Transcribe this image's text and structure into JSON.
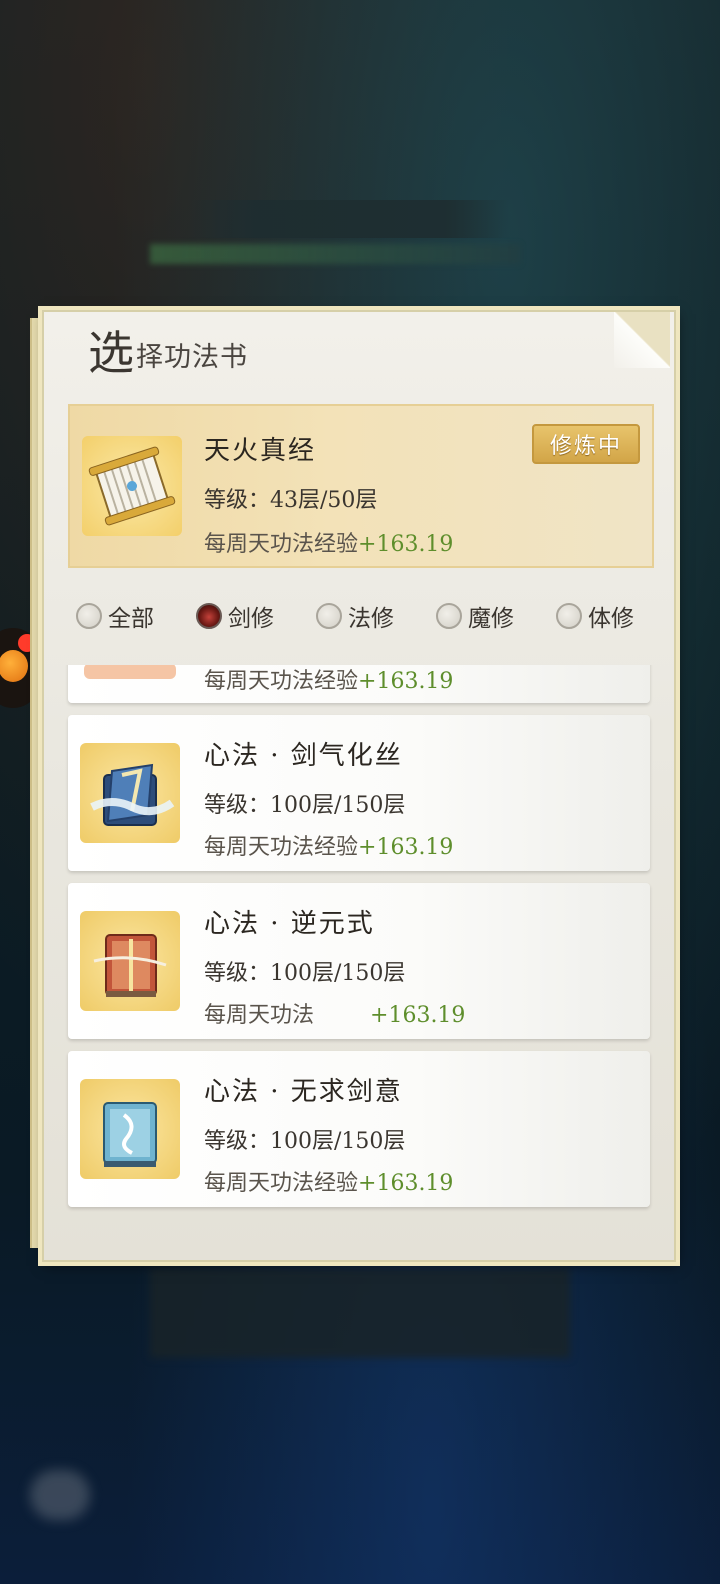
{
  "panel": {
    "title_first": "选",
    "title_rest": "择功法书"
  },
  "current": {
    "name": "天火真经",
    "level": "等级：43层/50层",
    "exp_label": "每周天功法经验",
    "exp_value": "+163.19",
    "badge": "修炼中",
    "icon": "scroll-icon"
  },
  "filters": [
    {
      "label": "全部",
      "selected": false
    },
    {
      "label": "剑修",
      "selected": true
    },
    {
      "label": "法修",
      "selected": false
    },
    {
      "label": "魔修",
      "selected": false
    },
    {
      "label": "体修",
      "selected": false
    }
  ],
  "list": [
    {
      "name": "",
      "level": "",
      "exp_label": "每周天功法经验",
      "exp_value": "+163.19",
      "icon": "book-icon"
    },
    {
      "name": "心法 · 剑气化丝",
      "level": "等级：100层/150层",
      "exp_label": "每周天功法经验",
      "exp_value": "+163.19",
      "icon": "sword-book-icon"
    },
    {
      "name": "心法 · 逆元式",
      "level": "等级：100层/150层",
      "exp_label": "每周天功法",
      "exp_value": "+163.19",
      "icon": "red-book-icon"
    },
    {
      "name": "心法 · 无求剑意",
      "level": "等级：100层/150层",
      "exp_label": "每周天功法经验",
      "exp_value": "+163.19",
      "icon": "blue-book-icon"
    }
  ]
}
